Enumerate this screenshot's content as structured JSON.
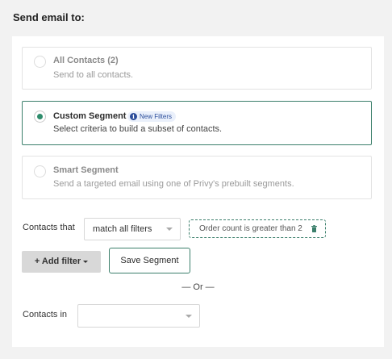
{
  "heading": "Send email to:",
  "options": [
    {
      "title": "All Contacts (2)",
      "description": "Send to all contacts.",
      "selected": false
    },
    {
      "title": "Custom Segment",
      "badge": "New Filters",
      "description": "Select criteria to build a subset of contacts.",
      "selected": true
    },
    {
      "title": "Smart Segment",
      "description": "Send a targeted email using one of Privy's prebuilt segments.",
      "selected": false
    }
  ],
  "filters": {
    "contacts_that_label": "Contacts that",
    "match_select_value": "match all filters",
    "active_filter": "Order count is greater than 2",
    "add_filter_label": "+ Add filter",
    "save_segment_label": "Save Segment"
  },
  "divider_text": "— Or —",
  "contacts_in": {
    "label": "Contacts in",
    "select_value": ""
  },
  "colors": {
    "accent": "#3b7f6b",
    "radio_checked": "#2f8c6c",
    "badge_bg": "#eaf0fb",
    "badge_text": "#2a4c9a",
    "page_bg": "#f2f2f2"
  },
  "icons": {
    "badge_icon": "info-icon",
    "chip_icon": "trash-icon",
    "select_icon": "chevron-down-icon"
  }
}
